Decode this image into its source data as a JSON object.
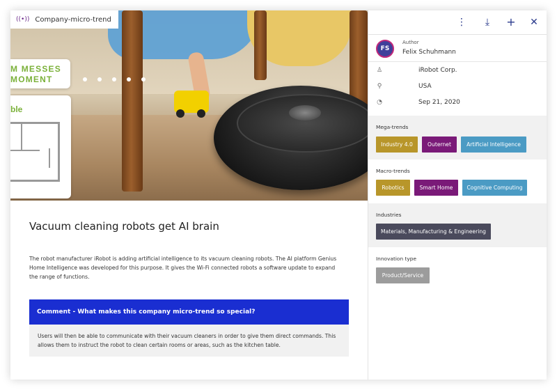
{
  "tag": {
    "icon": "signal-icon",
    "label": "Company-micro-trend"
  },
  "hero": {
    "ad_line1": "M MESSES",
    "ad_line2": "MOMENT",
    "ad_ble": "ble"
  },
  "article": {
    "title": "Vacuum cleaning robots get AI brain",
    "description": "The robot manufacturer iRobot is adding artificial intelligence to its vacuum cleaning robots. The AI platform Genius Home Intelligence was developed for this purpose. It gives the Wi-Fi connected robots a software update to expand the range of functions.",
    "comment_heading": "Comment - What makes this company micro-trend so special?",
    "comment_body": "Users will then be able to communicate with their vacuum cleaners in order to give them direct commands. This allows them to instruct the robot to clean certain rooms or areas, such as the kitchen table."
  },
  "toolbar": {
    "more": "⋮",
    "download": "⤓",
    "add": "+",
    "close": "✕"
  },
  "author": {
    "label": "Author",
    "name": "Felix Schuhmann",
    "initials": "FS"
  },
  "info": {
    "company": "iRobot Corp.",
    "location": "USA",
    "date": "Sep 21, 2020"
  },
  "sections": {
    "mega": {
      "title": "Mega-trends",
      "chips": [
        {
          "label": "Industry 4.0",
          "color": "#b8962a"
        },
        {
          "label": "Outernet",
          "color": "#7a1a78"
        },
        {
          "label": "Artificial Intelligence",
          "color": "#4b9bc4"
        }
      ]
    },
    "macro": {
      "title": "Macro-trends",
      "chips": [
        {
          "label": "Robotics",
          "color": "#b8962a"
        },
        {
          "label": "Smart Home",
          "color": "#7a1a78"
        },
        {
          "label": "Cognitive Computing",
          "color": "#4b9bc4"
        }
      ]
    },
    "industries": {
      "title": "Industries",
      "chips": [
        {
          "label": "Materials, Manufacturing & Engineering",
          "color": "#4a4a5c"
        }
      ]
    },
    "innovation": {
      "title": "Innovation type",
      "chips": [
        {
          "label": "Product/Service",
          "color": "#9c9c9c"
        }
      ]
    }
  }
}
